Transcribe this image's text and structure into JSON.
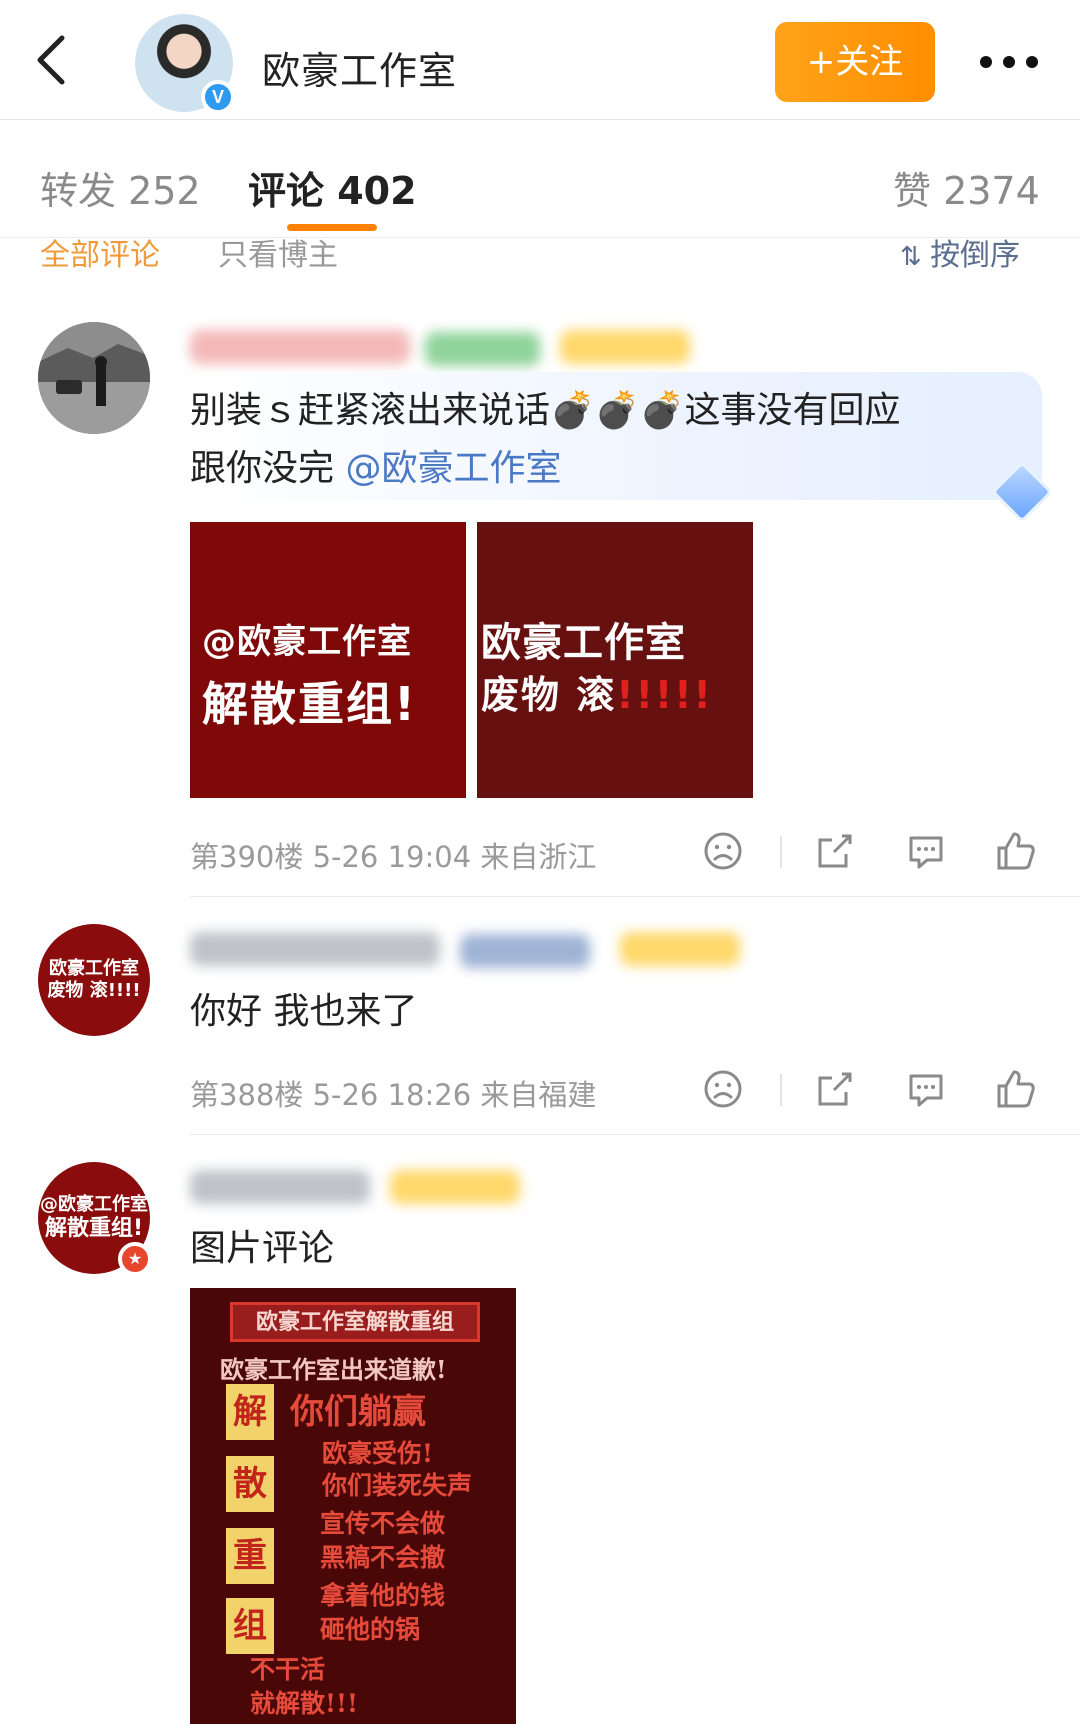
{
  "header": {
    "title": "欧豪工作室",
    "follow_label": "+关注",
    "verified_mark": "V"
  },
  "tabs": {
    "repost": "转发 252",
    "comments": "评论 402",
    "likes": "赞 2374"
  },
  "filter": {
    "all": "全部评论",
    "host_only": "只看博主",
    "sort": "按倒序"
  },
  "comments": [
    {
      "text_line1": "别装ｓ赶紧滚出来说话💣💣💣这事没有回应",
      "text_line2_prefix": "跟你没完 ",
      "mention": "@欧豪工作室",
      "images": [
        {
          "line1": "@欧豪工作室",
          "line2": "解散重组!"
        },
        {
          "line1": "欧豪工作室",
          "line2": "废物 滚",
          "line2_marks": "!!!!!"
        }
      ],
      "meta": "第390楼 5-26 19:04 来自浙江"
    },
    {
      "avatar_line1": "欧豪工作室",
      "avatar_line2": "废物 滚!!!!",
      "text": "你好  我也来了",
      "meta": "第388楼 5-26 18:26 来自福建"
    },
    {
      "avatar_line1": "@欧豪工作室",
      "avatar_line2": "解散重组!",
      "text": "图片评论",
      "poster": {
        "header": "欧豪工作室解散重组",
        "subheader": "欧豪工作室出来道歉!",
        "side_chars": [
          "解",
          "散",
          "重",
          "组"
        ],
        "lines": [
          "你们躺赢",
          "欧豪受伤!",
          "你们装死失声",
          "宣传不会做",
          "黑稿不会撤",
          "拿着他的钱",
          "砸他的锅",
          "不干活",
          "就解散!!!"
        ]
      }
    }
  ],
  "icons": {
    "back": "chevron-left-icon",
    "more": "more-dots-icon",
    "sort": "sort-icon",
    "dislike": "sad-face-icon",
    "share": "share-icon",
    "reply": "comment-icon",
    "like": "thumbs-up-icon",
    "gem": "diamond-icon"
  },
  "colors": {
    "accent": "#ff8200",
    "mention": "#4a79c5",
    "poster_red": "#7f0808"
  }
}
